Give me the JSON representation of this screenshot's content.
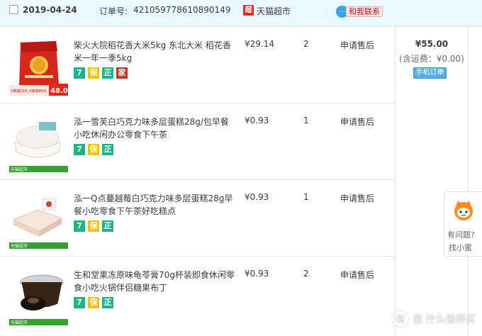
{
  "header": {
    "date": "2019-04-24",
    "order_label": "订单号:",
    "order_no": "421059778610890149",
    "shop_badge": "超",
    "shop_name": "天猫超市",
    "contact_label": "和我联系"
  },
  "items": [
    {
      "title": "柴火大院稻花香大米5kg 东北大米 稻花香米一年一季5kg",
      "price": "¥29.14",
      "qty": "2",
      "service": "申请售后",
      "tags": [
        "7",
        "保",
        "正",
        "家"
      ],
      "thumb_price": "48.0",
      "thumb_caption": "1袋减20元 2袋减40元"
    },
    {
      "title": "泓一雪芙白巧克力味多层蛋糕28g/包早餐小吃休闲办公零食下午茶",
      "price": "¥0.93",
      "qty": "1",
      "service": "申请售后",
      "tags": [
        "7",
        "保",
        "正"
      ],
      "thumb_caption": "天猫超市"
    },
    {
      "title": "泓一Q点蔓越莓白巧克力味多层蛋糕28g早餐小吃零食下午茶好吃糕点",
      "price": "¥0.93",
      "qty": "1",
      "service": "申请售后",
      "tags": [
        "7",
        "保",
        "正"
      ],
      "thumb_caption": "天猫超市"
    },
    {
      "title": "生和堂果冻原味龟苓膏70g杯装即食休闲零食小吃火锅伴侣糖果布丁",
      "price": "¥0.93",
      "qty": "2",
      "service": "申请售后",
      "tags": [
        "7",
        "保",
        "正"
      ],
      "thumb_caption": "天猫超市"
    }
  ],
  "total": {
    "amount": "¥55.00",
    "shipping": "(含运费：¥0.00)",
    "mobile_badge": "手机订单"
  },
  "help_widget": {
    "line1": "有问题?",
    "line2": "找小蜜"
  },
  "watermark": {
    "text": "值 什么值得买",
    "icon": "zhi-icon"
  },
  "colors": {
    "header_bg": "#eaf8ff",
    "tag_green": "#20b28a",
    "tag_yellow": "#f6c400",
    "tag_red": "#c4361a",
    "shop_red": "#e52a2a"
  }
}
